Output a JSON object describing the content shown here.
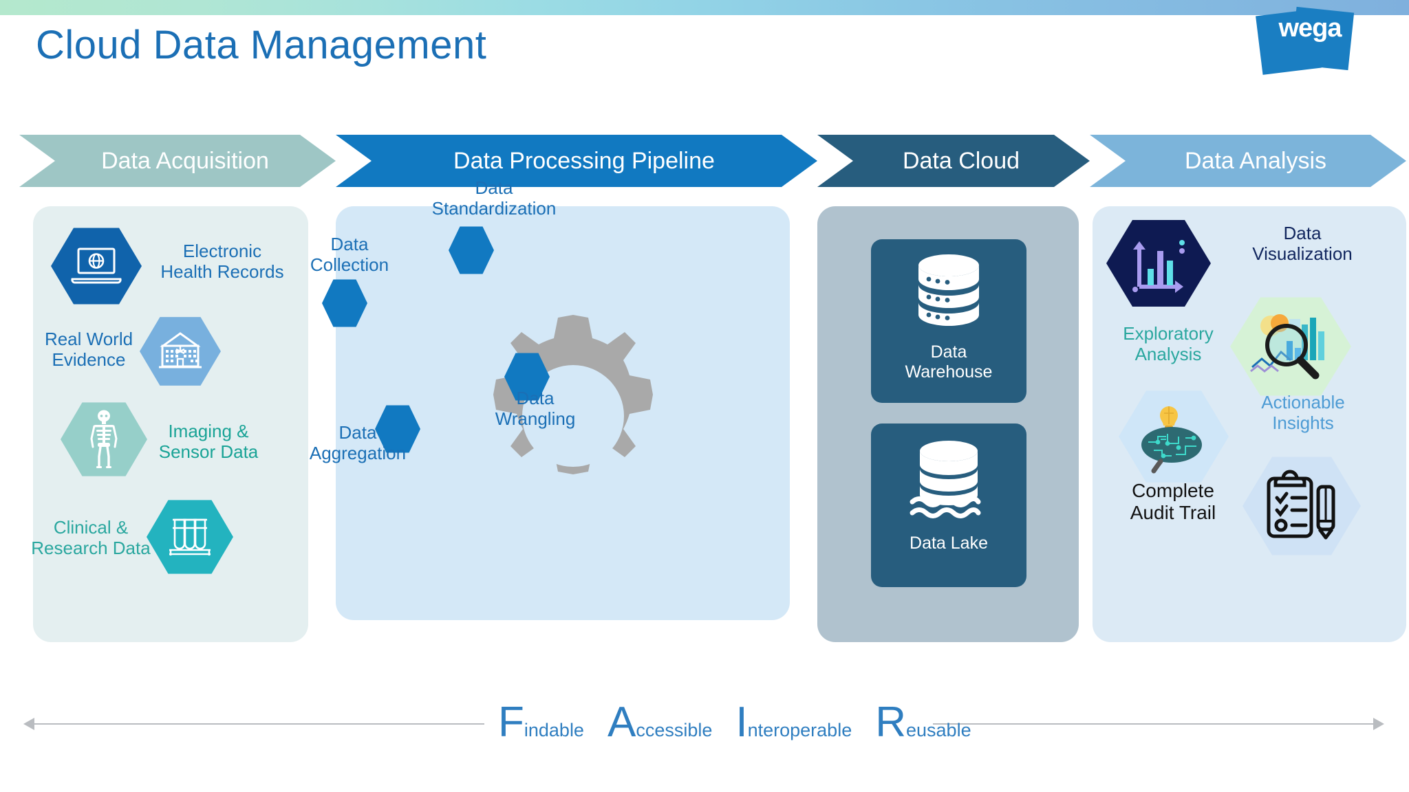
{
  "header": {
    "title": "Cloud Data Management",
    "logo_text": "wega",
    "title_color": "#1b6fb5",
    "topbar_gradient_from": "#b4e8cd",
    "topbar_gradient_to": "#7fb0dd"
  },
  "stages": [
    {
      "id": "data-acquisition",
      "label": "Data Acquisition",
      "color": "#9ec6c5",
      "panel_bg": "#e4eff0"
    },
    {
      "id": "data-processing-pipeline",
      "label": "Data Processing Pipeline",
      "color": "#1179c1",
      "panel_bg": "#d4e8f7"
    },
    {
      "id": "data-cloud",
      "label": "Data Cloud",
      "color": "#275d7e",
      "panel_bg": "#b0c2ce"
    },
    {
      "id": "data-analysis",
      "label": "Data Analysis",
      "color": "#7cb4da",
      "panel_bg": "#dceaf5"
    }
  ],
  "acquisition": {
    "items": [
      {
        "label": "Electronic\nHealth Records",
        "icon": "laptop-globe-icon",
        "hex_color": "#1063ab",
        "text_color": "#1b6fb5",
        "side": "right"
      },
      {
        "label": "Real World\nEvidence",
        "icon": "hospital-icon",
        "hex_color": "#78b0de",
        "text_color": "#1b6fb5",
        "side": "left"
      },
      {
        "label": "Imaging &\nSensor Data",
        "icon": "skeleton-icon",
        "hex_color": "#96cfc9",
        "text_color": "#19a396",
        "side": "right"
      },
      {
        "label": "Clinical &\nResearch Data",
        "icon": "test-tubes-icon",
        "hex_color": "#23b3bf",
        "text_color": "#2aa79f",
        "side": "right"
      }
    ]
  },
  "pipeline": {
    "gear_color": "#a9a9a9",
    "hex_color": "#1179c1",
    "text_color": "#1b6fb5",
    "nodes": [
      {
        "label": "Data\nStandardization",
        "position": "top-right"
      },
      {
        "label": "Data\nCollection",
        "position": "top-left"
      },
      {
        "label": "Data\nWrangling",
        "position": "bottom-right"
      },
      {
        "label": "Data\nAggregation",
        "position": "bottom-left"
      }
    ]
  },
  "cloud": {
    "card_color": "#275d7e",
    "cards": [
      {
        "label": "Data\nWarehouse",
        "icon": "database-stack-icon"
      },
      {
        "label": "Data Lake",
        "icon": "data-lake-icon"
      }
    ]
  },
  "analysis": {
    "items": [
      {
        "label": "Data\nVisualization",
        "icon": "bar-chart-axis-icon",
        "hex_color": "#0e1a52",
        "text_color": "#11265e",
        "side": "right"
      },
      {
        "label": "Exploratory\nAnalysis",
        "icon": "magnifier-chart-icon",
        "hex_color": "#d6f2d6",
        "text_color": "#2aa79f",
        "side": "left"
      },
      {
        "label": "Actionable\nInsights",
        "icon": "brain-bulb-icon",
        "hex_color": "#cfe6f8",
        "text_color": "#4d9bd4",
        "side": "right"
      },
      {
        "label": "Complete\nAudit Trail",
        "icon": "clipboard-pencil-icon",
        "hex_color": "#cfe2f5",
        "text_color": "#121212",
        "side": "left"
      }
    ]
  },
  "fair": {
    "color": "#2f7ec0",
    "words": [
      {
        "initial": "F",
        "rest": "indable"
      },
      {
        "initial": "A",
        "rest": "ccessible"
      },
      {
        "initial": "I",
        "rest": "nteroperable"
      },
      {
        "initial": "R",
        "rest": "eusable"
      }
    ],
    "arrow_color": "#b9bcc0"
  }
}
